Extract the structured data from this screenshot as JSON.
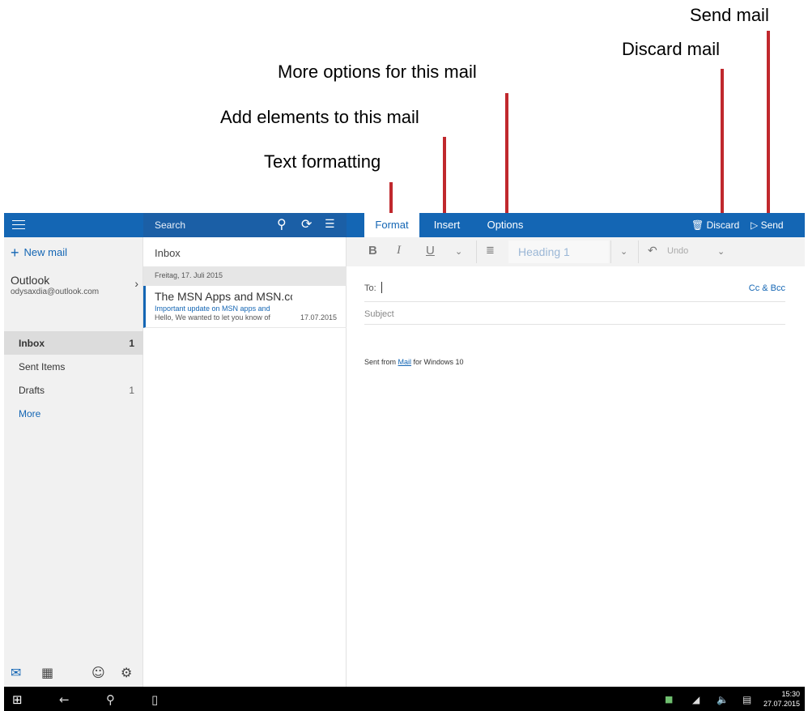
{
  "annotations": {
    "send_mail": "Send mail",
    "discard_mail": "Discard mail",
    "more_options": "More options for this mail",
    "add_elements": "Add elements to this mail",
    "text_formatting": "Text formatting",
    "line_color": "#c0282d"
  },
  "topbar": {
    "search_label": "Search",
    "tabs": [
      {
        "label": "Format",
        "active": true
      },
      {
        "label": "Insert",
        "active": false
      },
      {
        "label": "Options",
        "active": false
      }
    ],
    "discard_label": "Discard",
    "send_label": "Send",
    "accent": "#1466b4"
  },
  "leftnav": {
    "new_mail_label": "New mail",
    "account_name": "Outlook",
    "account_email": "odysaxdia@outlook.com",
    "folders": [
      {
        "name": "Inbox",
        "count": "1"
      },
      {
        "name": "Sent Items",
        "count": ""
      },
      {
        "name": "Drafts",
        "count": "1"
      }
    ],
    "more_label": "More"
  },
  "msglist": {
    "title": "Inbox",
    "date_header": "Freitag, 17. Juli 2015",
    "messages": [
      {
        "sender": "The MSN Apps and MSN.cc",
        "subject": "Important update on MSN apps and",
        "preview": "Hello, We wanted to let you know of",
        "date": "17.07.2015"
      }
    ]
  },
  "compose": {
    "heading_style": "Heading 1",
    "undo_label": "Undo",
    "to_label": "To:",
    "cc_bcc_label": "Cc & Bcc",
    "subject_placeholder": "Subject",
    "signature_prefix": "Sent from ",
    "signature_link": "Mail",
    "signature_suffix": " for Windows 10"
  },
  "taskbar": {
    "time": "15:30",
    "date": "27.07.2015"
  }
}
